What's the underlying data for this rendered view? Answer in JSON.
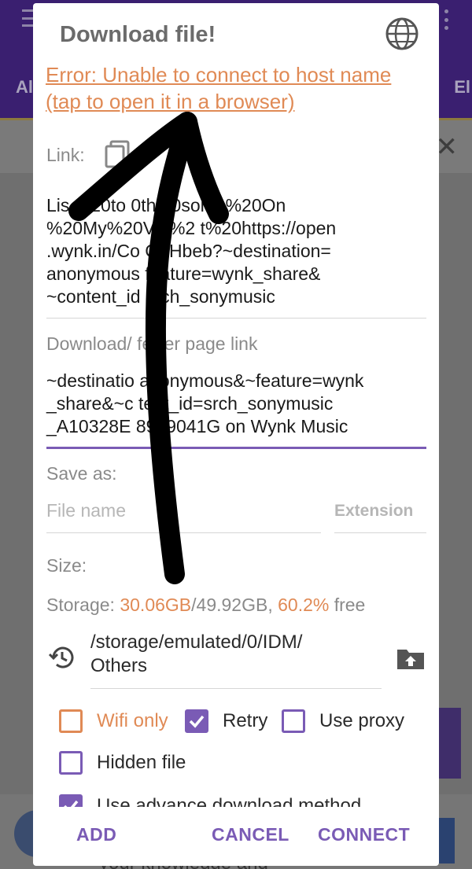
{
  "background": {
    "tab_left": "Al",
    "tab_right": "El",
    "footer_text": "your knowledge and"
  },
  "dialog": {
    "title": "Download file!",
    "error_line1": "Error: Unable to connect to host name",
    "error_line2": "(tap to open it in a browser)",
    "link_label": "Link:",
    "link_lines": [
      "Lis  %20to  0th  20song:%20On",
      "%20My%20V    y%2   t%20https://open",
      ".wynk.in/Co   GbHbeb?~destination=",
      "anonymous   feature=wynk_share&",
      "~content_id  srch_sonymusic"
    ],
    "referrer_label": "Download/   ferrer page link",
    "referrer_lines": [
      "~destinatio  anonymous&~feature=wynk",
      "_share&~c   tent_id=srch_sonymusic",
      "_A10328E   8969041G on Wynk Music"
    ],
    "save_as_label": "Save as:",
    "file_name_placeholder": "File name",
    "extension_placeholder": "Extension",
    "size_label": "Size:",
    "storage_prefix": "Storage: ",
    "storage_used": "30.06GB",
    "storage_total": "/49.92GB, ",
    "storage_percent": "60.2%",
    "storage_suffix": " free",
    "path_line1": "/storage/emulated/0/IDM/",
    "path_line2": "Others",
    "options": {
      "wifi_only": "Wifi only",
      "retry": "Retry",
      "use_proxy": "Use proxy",
      "hidden_file": "Hidden file",
      "advanced": "Use advance download method"
    },
    "buttons": {
      "add": "ADD",
      "cancel": "CANCEL",
      "connect": "CONNECT"
    }
  },
  "colors": {
    "accent": "#7a5bb5",
    "warning": "#e08a55"
  },
  "icons": [
    "globe-icon",
    "copy-icon",
    "history-icon",
    "folder-upload-icon",
    "check-icon",
    "menu-icon",
    "more-icon",
    "close-icon"
  ]
}
